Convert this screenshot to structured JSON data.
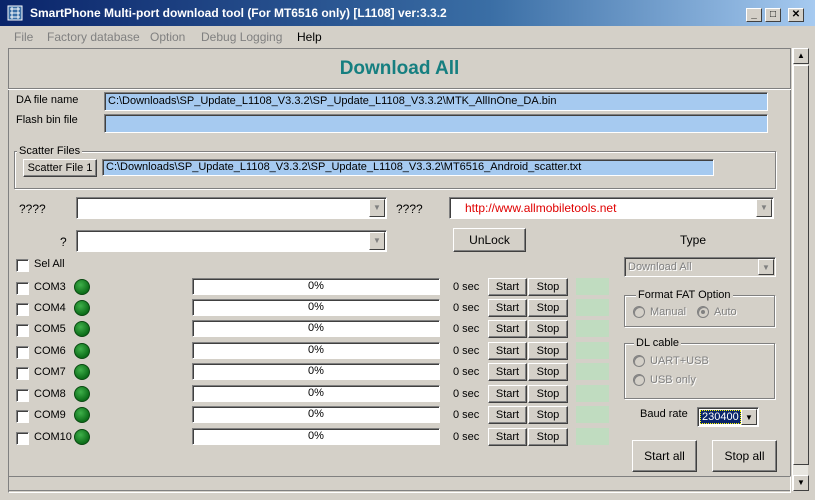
{
  "window": {
    "title": "SmartPhone Multi-port download tool (For MT6516 only) [L1108] ver:3.3.2"
  },
  "menu": [
    "File",
    "Factory database",
    "Option",
    "Debug Logging",
    "Help"
  ],
  "heading": "Download All",
  "da_file": {
    "label": "DA file name",
    "value": "C:\\Downloads\\SP_Update_L1108_V3.3.2\\SP_Update_L1108_V3.3.2\\MTK_AllInOne_DA.bin"
  },
  "flash_bin": {
    "label": "Flash bin  file",
    "value": ""
  },
  "scatter": {
    "group": "Scatter Files",
    "button": "Scatter File 1",
    "value": "C:\\Downloads\\SP_Update_L1108_V3.3.2\\SP_Update_L1108_V3.3.2\\MT6516_Android_scatter.txt"
  },
  "combo1": {
    "label": "????",
    "value": ""
  },
  "combo2": {
    "label": "????",
    "value": "http://www.allmobiletools.net"
  },
  "combo3": {
    "label": "?",
    "value": ""
  },
  "unlock": "UnLock",
  "type": {
    "label": "Type",
    "value": "Download All"
  },
  "sel_all": "Sel All",
  "ports": [
    {
      "name": "COM3",
      "progress": "0%",
      "time": "0 sec"
    },
    {
      "name": "COM4",
      "progress": "0%",
      "time": "0 sec"
    },
    {
      "name": "COM5",
      "progress": "0%",
      "time": "0 sec"
    },
    {
      "name": "COM6",
      "progress": "0%",
      "time": "0 sec"
    },
    {
      "name": "COM7",
      "progress": "0%",
      "time": "0 sec"
    },
    {
      "name": "COM8",
      "progress": "0%",
      "time": "0 sec"
    },
    {
      "name": "COM9",
      "progress": "0%",
      "time": "0 sec"
    },
    {
      "name": "COM10",
      "progress": "0%",
      "time": "0 sec"
    }
  ],
  "start_label": "Start",
  "stop_label": "Stop",
  "format_fat": {
    "title": "Format FAT Option",
    "manual": "Manual",
    "auto": "Auto"
  },
  "dl_cable": {
    "title": "DL cable",
    "uart": "UART+USB",
    "usb": "USB only"
  },
  "baud": {
    "label": "Baud rate",
    "value": "230400"
  },
  "start_all": "Start all",
  "stop_all": "Stop all"
}
